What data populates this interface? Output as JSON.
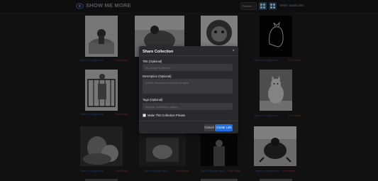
{
  "app": {
    "brand": "SHOW ME MORE",
    "sort_value": "Default",
    "select_duplicates": "Select Duplicates"
  },
  "gallery": {
    "captions": [
      {
        "left": "Open in Google Lens",
        "right": "Find Similar"
      },
      {
        "left": "Open in Google Lens",
        "right": "Find Similar"
      },
      {
        "left": "Open in Google Lens",
        "right": "Find Similar"
      },
      {
        "left": "Open in Google Lens",
        "right": "Find Similar"
      },
      {
        "left": "Open in Google Lens",
        "right": "Find Similar"
      },
      {
        "left": "Open in Google Lens",
        "right": "Find Similar"
      },
      {
        "left": "Open in Google Lens",
        "right": "Find Similar"
      },
      {
        "left": "Open in Google Lens",
        "right": "Find Similar"
      },
      {
        "left": "Open in Google Lens",
        "right": "Find Similar"
      },
      {
        "left": "Open in Google Lens",
        "right": "Find Similar"
      },
      {
        "left": "Open in Google Lens",
        "right": "Find Similar"
      },
      {
        "left": "Open in Google Lens",
        "right": "Find Similar"
      }
    ]
  },
  "modal": {
    "title": "Share Collection",
    "close": "×",
    "title_label": "Title (Optional)",
    "title_placeholder": "My Image Collection",
    "desc_label": "Description (Optional)",
    "desc_placeholder": "A brief description of these images",
    "tags_label": "Tags (Optional)",
    "tags_placeholder": "images, collection, gallery",
    "private_label": "Make This Collection Private",
    "cancel": "Cancel",
    "create": "Create Link"
  },
  "colors": {
    "accent": "#1e6fe0",
    "link_blue": "#3a6fd1",
    "link_red": "#c04040"
  }
}
